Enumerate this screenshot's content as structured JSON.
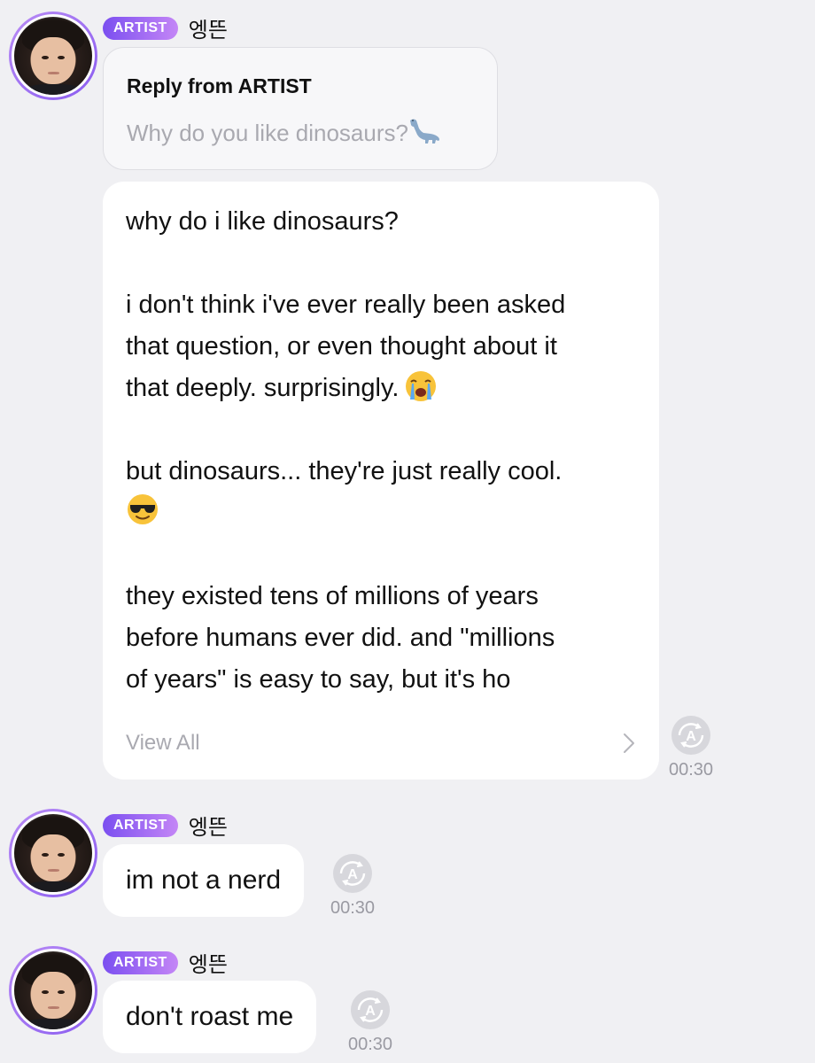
{
  "author": {
    "badge": "ARTIST",
    "name": "엥뜬"
  },
  "messages": [
    {
      "type": "reply",
      "reply_title": "Reply from ARTIST",
      "reply_quote": "Why do you like dinosaurs?",
      "reply_quote_icon": "dinosaur-icon",
      "lines": [
        "why do i like dinosaurs?",
        "",
        "i don't think i've ever really been asked",
        "that question, or even thought about it",
        "that deeply. surprisingly.",
        "",
        "but dinosaurs... they're just really cool.",
        "",
        "",
        "they existed tens of millions of years",
        "before humans ever did. and \"millions",
        "of years\" is easy to say, but it's ho"
      ],
      "emojis": [
        "loudly-crying-face",
        "smiling-face-with-sunglasses"
      ],
      "view_all": "View All",
      "time": "00:30"
    },
    {
      "type": "text",
      "text": "im not a nerd",
      "time": "00:30"
    },
    {
      "type": "text",
      "text": "don't roast me",
      "time": "00:30"
    }
  ],
  "colors": {
    "background": "#f0f0f3",
    "badge_gradient_start": "#7b4ff0",
    "badge_gradient_end": "#c486f6",
    "bubble": "#ffffff",
    "muted_text": "#a9a9b0"
  }
}
